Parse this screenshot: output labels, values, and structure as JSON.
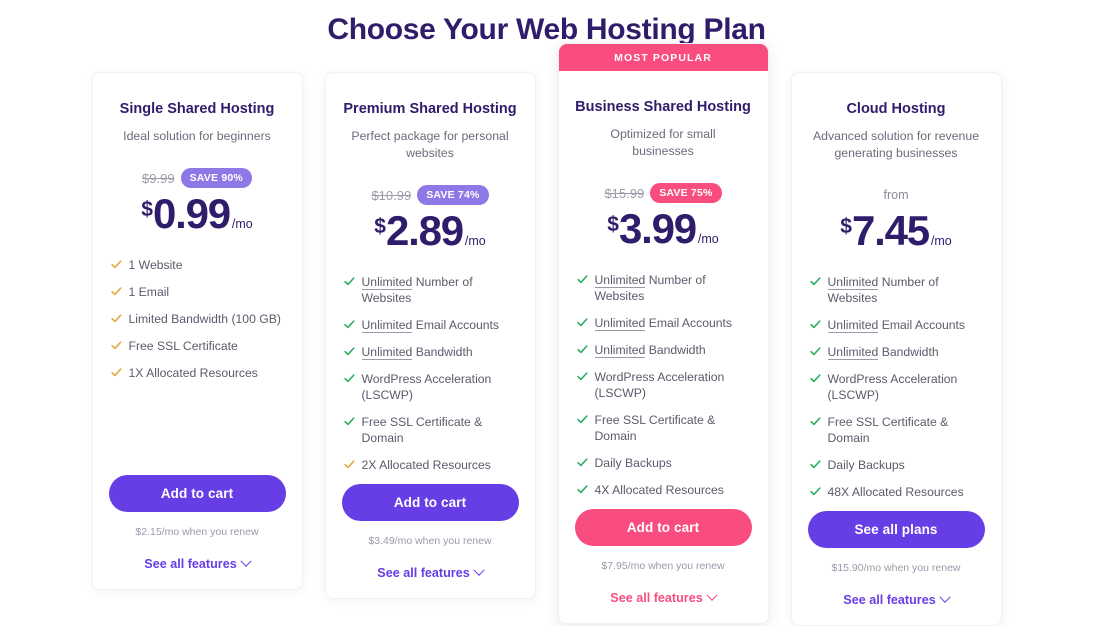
{
  "header": {
    "title": "Choose Your Web Hosting Plan"
  },
  "theme": {
    "purple": "#673de6",
    "badge_purple": "#8d78e6",
    "pink": "#f94c7f",
    "heading": "#2f1c6a",
    "check_green": "#27ae60",
    "check_amber": "#e0a93b"
  },
  "chevron_icon": "chevron-down-icon",
  "plans": [
    {
      "ribbon": null,
      "name": "Single Shared Hosting",
      "description": "Ideal solution for beginners",
      "from_label": null,
      "old_price": "$9.99",
      "save_badge": "SAVE 90%",
      "badge_color": "purple",
      "currency": "$",
      "amount": "0.99",
      "period": "/mo",
      "features": [
        {
          "highlight": "",
          "text": "1 Website",
          "check": "amber"
        },
        {
          "highlight": "",
          "text": "1 Email",
          "check": "amber"
        },
        {
          "highlight": "",
          "text": "Limited Bandwidth (100 GB)",
          "check": "amber"
        },
        {
          "highlight": "",
          "text": "Free SSL Certificate",
          "check": "amber"
        },
        {
          "highlight": "",
          "text": "1X Allocated Resources",
          "check": "amber"
        }
      ],
      "cta_label": "Add to cart",
      "cta_color": "purple",
      "renew_note": "$2.15/mo when you renew",
      "see_all_label": "See all features",
      "link_color": "purple"
    },
    {
      "ribbon": null,
      "name": "Premium Shared Hosting",
      "description": "Perfect package for personal websites",
      "from_label": null,
      "old_price": "$10.99",
      "save_badge": "SAVE 74%",
      "badge_color": "purple",
      "currency": "$",
      "amount": "2.89",
      "period": "/mo",
      "features": [
        {
          "highlight": "Unlimited",
          "text": " Number of Websites",
          "check": "green"
        },
        {
          "highlight": "Unlimited",
          "text": " Email Accounts",
          "check": "green"
        },
        {
          "highlight": "Unlimited",
          "text": " Bandwidth",
          "check": "green"
        },
        {
          "highlight": "",
          "text": "WordPress Acceleration (LSCWP)",
          "check": "green"
        },
        {
          "highlight": "",
          "text": "Free SSL Certificate & Domain",
          "check": "green"
        },
        {
          "highlight": "",
          "text": "2X Allocated Resources",
          "check": "amber"
        }
      ],
      "cta_label": "Add to cart",
      "cta_color": "purple",
      "renew_note": "$3.49/mo when you renew",
      "see_all_label": "See all features",
      "link_color": "purple"
    },
    {
      "ribbon": "MOST POPULAR",
      "name": "Business Shared Hosting",
      "description": "Optimized for small businesses",
      "from_label": null,
      "old_price": "$15.99",
      "save_badge": "SAVE 75%",
      "badge_color": "pink",
      "currency": "$",
      "amount": "3.99",
      "period": "/mo",
      "features": [
        {
          "highlight": "Unlimited",
          "text": " Number of Websites",
          "check": "green"
        },
        {
          "highlight": "Unlimited",
          "text": " Email Accounts",
          "check": "green"
        },
        {
          "highlight": "Unlimited",
          "text": " Bandwidth",
          "check": "green"
        },
        {
          "highlight": "",
          "text": "WordPress Acceleration (LSCWP)",
          "check": "green"
        },
        {
          "highlight": "",
          "text": "Free SSL Certificate & Domain",
          "check": "green"
        },
        {
          "highlight": "",
          "text": "Daily Backups",
          "check": "green"
        },
        {
          "highlight": "",
          "text": "4X Allocated Resources",
          "check": "green"
        }
      ],
      "cta_label": "Add to cart",
      "cta_color": "pink",
      "renew_note": "$7.95/mo when you renew",
      "see_all_label": "See all features",
      "link_color": "pink"
    },
    {
      "ribbon": null,
      "name": "Cloud Hosting",
      "description": "Advanced solution for revenue generating businesses",
      "from_label": "from",
      "old_price": null,
      "save_badge": null,
      "badge_color": null,
      "currency": "$",
      "amount": "7.45",
      "period": "/mo",
      "features": [
        {
          "highlight": "Unlimited",
          "text": " Number of Websites",
          "check": "green"
        },
        {
          "highlight": "Unlimited",
          "text": " Email Accounts",
          "check": "green"
        },
        {
          "highlight": "Unlimited",
          "text": " Bandwidth",
          "check": "green"
        },
        {
          "highlight": "",
          "text": "WordPress Acceleration (LSCWP)",
          "check": "green"
        },
        {
          "highlight": "",
          "text": "Free SSL Certificate & Domain",
          "check": "green"
        },
        {
          "highlight": "",
          "text": "Daily Backups",
          "check": "green"
        },
        {
          "highlight": "",
          "text": "48X Allocated Resources",
          "check": "green"
        }
      ],
      "cta_label": "See all plans",
      "cta_color": "purple",
      "renew_note": "$15.90/mo when you renew",
      "see_all_label": "See all features",
      "link_color": "purple"
    }
  ]
}
